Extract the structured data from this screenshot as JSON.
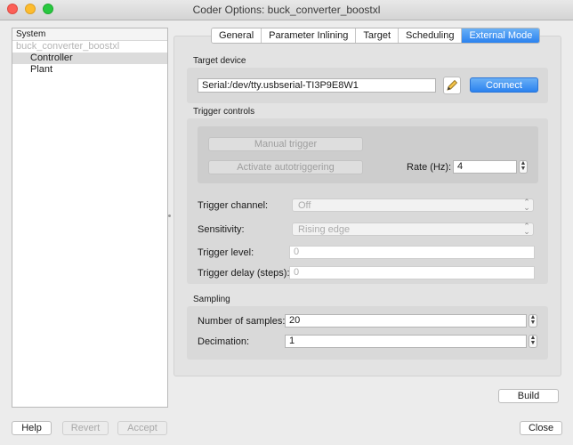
{
  "window": {
    "title": "Coder Options: buck_converter_boostxl"
  },
  "tree": {
    "header": "System",
    "root": "buck_converter_boostxl",
    "items": [
      "Controller",
      "Plant"
    ],
    "selected_index": 0
  },
  "tabs": [
    "General",
    "Parameter Inlining",
    "Target",
    "Scheduling",
    "External Mode"
  ],
  "active_tab": "External Mode",
  "target_device": {
    "label": "Target device",
    "value": "Serial:/dev/tty.usbserial-TI3P9E8W1",
    "edit_icon": "pencil-icon",
    "connect_label": "Connect"
  },
  "trigger_controls": {
    "label": "Trigger controls",
    "manual_trigger_label": "Manual trigger",
    "autotrigger_label": "Activate autotriggering",
    "rate_label": "Rate (Hz):",
    "rate_value": "4",
    "channel_label": "Trigger channel:",
    "channel_value": "Off",
    "sensitivity_label": "Sensitivity:",
    "sensitivity_value": "Rising edge",
    "level_label": "Trigger level:",
    "level_value": "0",
    "delay_label": "Trigger delay (steps):",
    "delay_value": "0"
  },
  "sampling": {
    "label": "Sampling",
    "samples_label": "Number of samples:",
    "samples_value": "20",
    "decimation_label": "Decimation:",
    "decimation_value": "1"
  },
  "buttons": {
    "build": "Build",
    "help": "Help",
    "revert": "Revert",
    "accept": "Accept",
    "close": "Close"
  },
  "colors": {
    "accent": "#2b82ef",
    "traffic_close": "#fc5f57",
    "traffic_min": "#fdbc2e",
    "traffic_max": "#28c840"
  }
}
